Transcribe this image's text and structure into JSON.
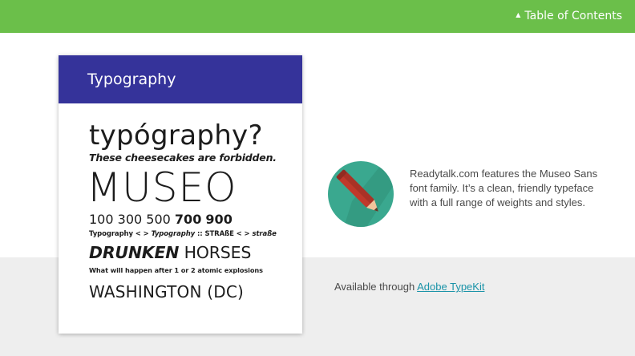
{
  "nav": {
    "toc_label": "Table of Contents",
    "caret_icon": "caret-up-icon"
  },
  "card": {
    "title": "Typography",
    "specimen": {
      "line1": "typógraphy?",
      "line2": "These cheesecakes are forbidden.",
      "line3": "MUSEO",
      "weights": [
        "100",
        "300",
        "500",
        "700",
        "900"
      ],
      "line5_part1": "Typography < > ",
      "line5_part2": "Typography",
      "line5_part3": " :: STRAßE < > ",
      "line5_part4": "straße",
      "line6_bold": "DRUNKEN",
      "line6_light": " HORSES",
      "line7": "What will happen after 1 or 2 atomic explosions",
      "line8": "WASHINGTON (DC)"
    }
  },
  "feature": {
    "icon": "pencil-icon",
    "description": "Readytalk.com features the Museo Sans font family. It’s a clean, friendly typeface with a full range of weights and styles."
  },
  "availability": {
    "prefix": "Available through ",
    "link_text": "Adobe TypeKit"
  },
  "colors": {
    "top_bar": "#6bbf4a",
    "card_header": "#35339a",
    "icon_circle": "#3aa88f",
    "link": "#1a93a8",
    "band": "#eeeeee"
  }
}
